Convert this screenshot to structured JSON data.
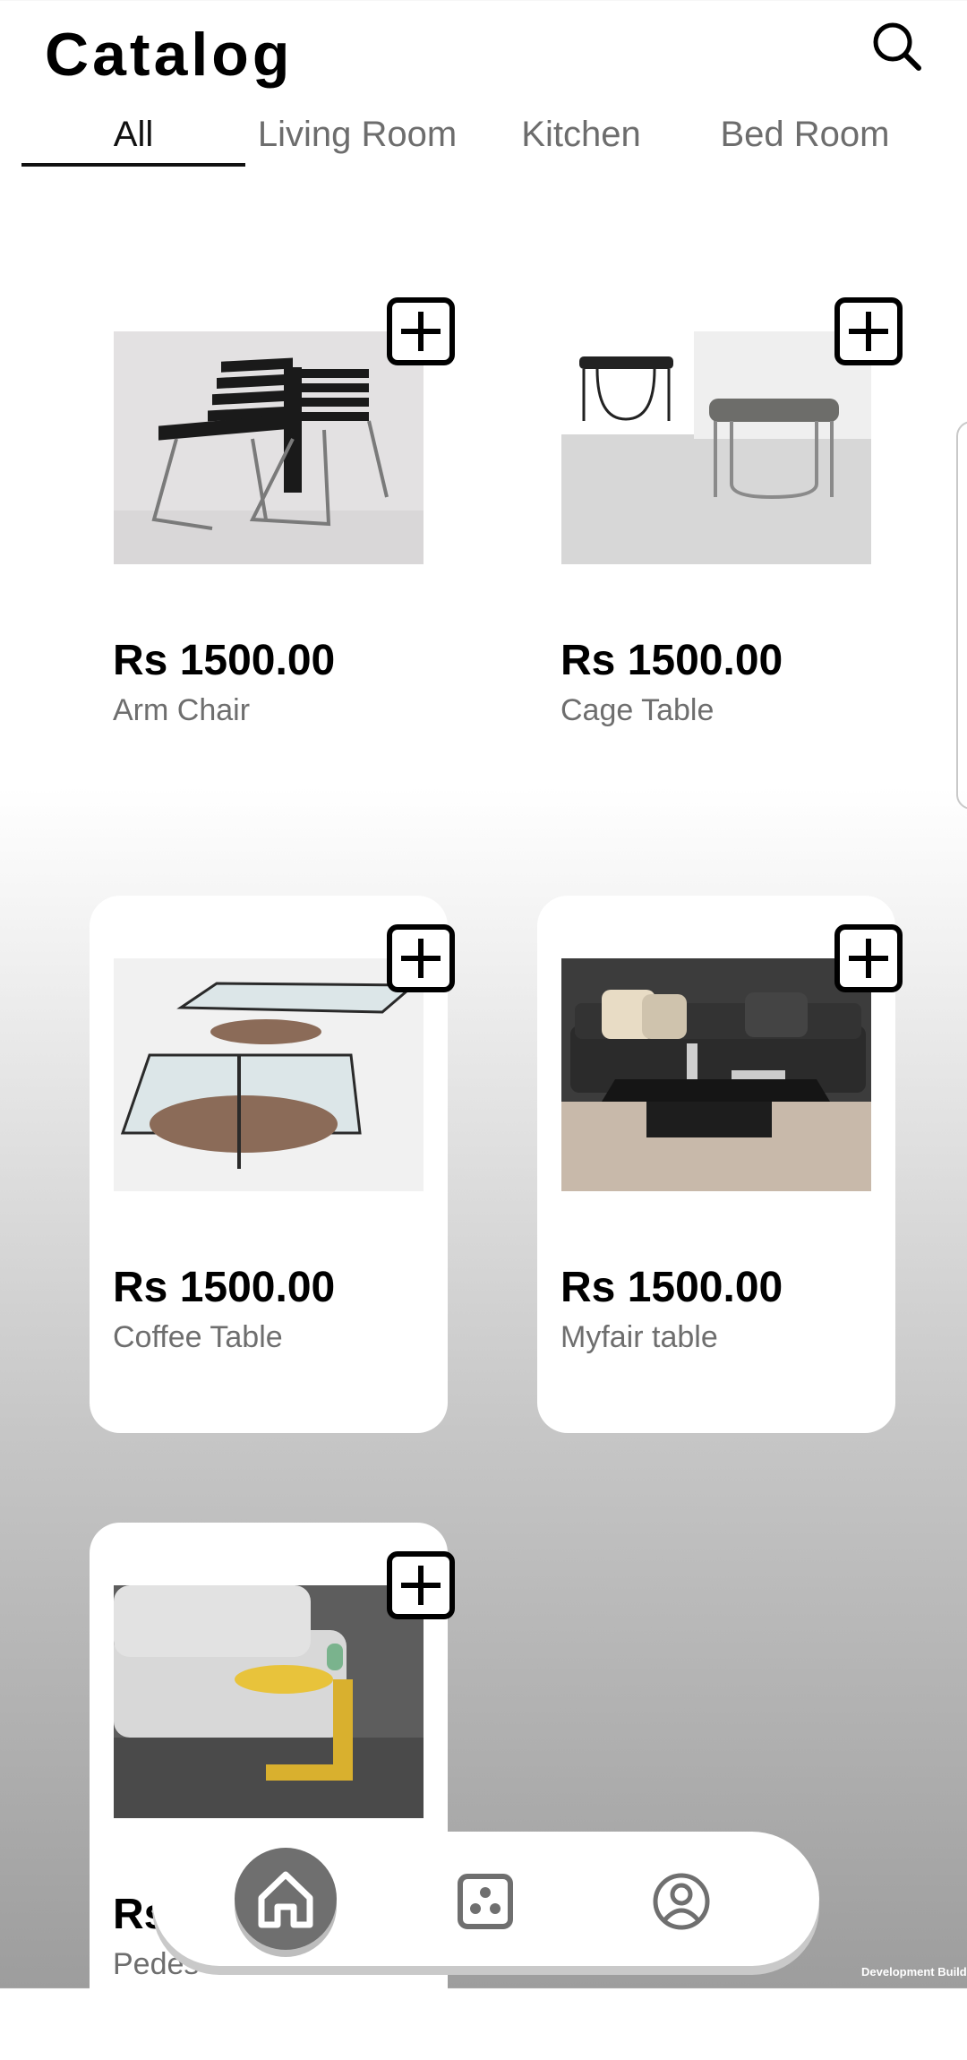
{
  "header": {
    "title": "Catalog",
    "search_icon": "search-icon"
  },
  "tabs": [
    {
      "label": "All",
      "active": true
    },
    {
      "label": "Living Room",
      "active": false
    },
    {
      "label": "Kitchen",
      "active": false
    },
    {
      "label": "Bed Room",
      "active": false
    }
  ],
  "products": [
    {
      "price": "Rs 1500.00",
      "name": "Arm Chair",
      "add_icon": "plus-square-icon"
    },
    {
      "price": "Rs 1500.00",
      "name": "Cage Table",
      "add_icon": "plus-square-icon"
    },
    {
      "price": "Rs 1500.00",
      "name": "Coffee Table",
      "add_icon": "plus-square-icon"
    },
    {
      "price": "Rs 1500.00",
      "name": "Myfair table",
      "add_icon": "plus-square-icon"
    },
    {
      "price": "Rs",
      "name": "Pedes",
      "add_icon": "plus-square-icon"
    }
  ],
  "navbar": {
    "items": [
      "home-icon",
      "dice-icon",
      "user-icon"
    ],
    "active": "home-icon"
  },
  "footer": {
    "dev_build": "Development Build"
  },
  "colors": {
    "text_primary": "#000000",
    "text_secondary": "#6e6e6e",
    "nav_active": "#6f6f6f"
  }
}
